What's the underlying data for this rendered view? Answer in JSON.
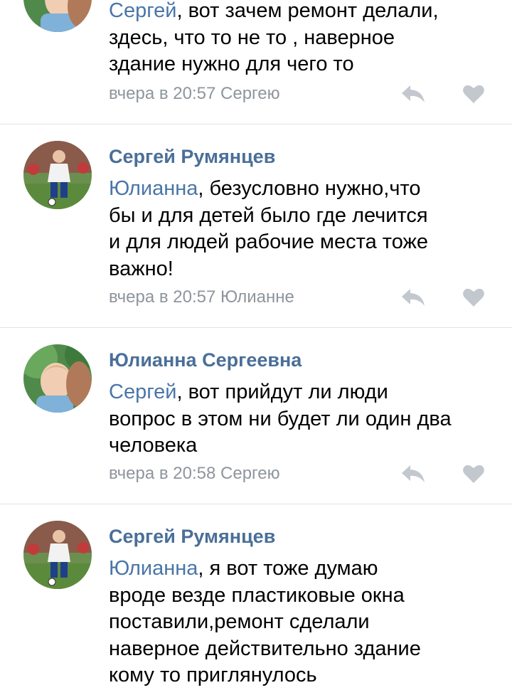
{
  "colors": {
    "author": "#4a6f98",
    "mention": "#4a76a8",
    "meta": "#8e959c",
    "icon": "#c3c8ce",
    "divider": "#dfe3e8"
  },
  "comments": [
    {
      "author": "",
      "avatar": "child-photo-avatar",
      "mention": "Сергей",
      "lines": [
        ", вот зачем ремонт делали,",
        "здесь, что то не то , наверное",
        "здание нужно для чего то"
      ],
      "meta": "вчера в 20:57 Сергею"
    },
    {
      "author": "Сергей Румянцев",
      "avatar": "footballer-photo-avatar",
      "mention": "Юлианна",
      "lines": [
        ", безусловно нужно,что",
        "бы и для детей было где лечится",
        "и для людей рабочие места тоже",
        "важно!"
      ],
      "meta": "вчера в 20:57 Юлианне"
    },
    {
      "author": "Юлианна Сергеевна",
      "avatar": "child-photo-avatar",
      "mention": "Сергей",
      "lines": [
        ", вот прийдут ли люди",
        "вопрос в этом ни будет ли один два",
        "человека"
      ],
      "meta": "вчера в 20:58 Сергею"
    },
    {
      "author": "Сергей Румянцев",
      "avatar": "footballer-photo-avatar",
      "mention": "Юлианна",
      "lines": [
        ", я вот тоже думаю",
        "вроде везде пластиковые окна",
        "поставили,ремонт сделали",
        "наверное действительно здание",
        "кому то приглянулось"
      ],
      "meta": ""
    }
  ],
  "icons": {
    "reply": "reply-icon",
    "like": "heart-icon"
  }
}
